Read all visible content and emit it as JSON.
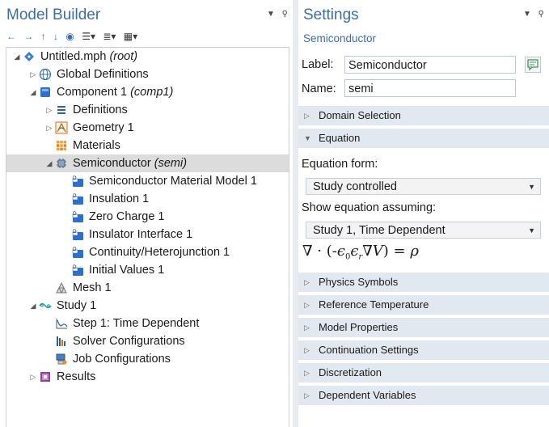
{
  "model_builder": {
    "title": "Model Builder",
    "header_icons": [
      "triangle-down-icon",
      "pin-icon"
    ],
    "toolbar": [
      "back-arrow-icon",
      "forward-arrow-icon",
      "up-arrow-icon",
      "down-arrow-icon",
      "show-icon",
      "expand-icon",
      "list-icon",
      "grid-icon"
    ],
    "tree": [
      {
        "label": "Untitled.mph",
        "suffix": "(root)",
        "level": 0,
        "toggle": "expanded",
        "icon": "root-file-icon"
      },
      {
        "label": "Global Definitions",
        "suffix": "",
        "level": 1,
        "toggle": "collapsed",
        "icon": "globe-icon"
      },
      {
        "label": "Component 1",
        "suffix": "(comp1)",
        "level": 1,
        "toggle": "expanded",
        "icon": "component-icon"
      },
      {
        "label": "Definitions",
        "suffix": "",
        "level": 2,
        "toggle": "collapsed",
        "icon": "definitions-icon"
      },
      {
        "label": "Geometry 1",
        "suffix": "",
        "level": 2,
        "toggle": "collapsed",
        "icon": "geometry-icon"
      },
      {
        "label": "Materials",
        "suffix": "",
        "level": 2,
        "toggle": "none",
        "icon": "materials-icon"
      },
      {
        "label": "Semiconductor",
        "suffix": "(semi)",
        "level": 2,
        "toggle": "expanded",
        "icon": "semiconductor-icon",
        "selected": true
      },
      {
        "label": "Semiconductor Material Model 1",
        "suffix": "",
        "level": 3,
        "toggle": "none",
        "icon": "physics-node-icon"
      },
      {
        "label": "Insulation 1",
        "suffix": "",
        "level": 3,
        "toggle": "none",
        "icon": "physics-node-icon"
      },
      {
        "label": "Zero Charge 1",
        "suffix": "",
        "level": 3,
        "toggle": "none",
        "icon": "physics-node-icon"
      },
      {
        "label": "Insulator Interface 1",
        "suffix": "",
        "level": 3,
        "toggle": "none",
        "icon": "physics-node-icon"
      },
      {
        "label": "Continuity/Heterojunction 1",
        "suffix": "",
        "level": 3,
        "toggle": "none",
        "icon": "physics-node-icon"
      },
      {
        "label": "Initial Values 1",
        "suffix": "",
        "level": 3,
        "toggle": "none",
        "icon": "physics-node-icon"
      },
      {
        "label": "Mesh 1",
        "suffix": "",
        "level": 2,
        "toggle": "none",
        "icon": "mesh-icon"
      },
      {
        "label": "Study 1",
        "suffix": "",
        "level": 1,
        "toggle": "expanded",
        "icon": "study-icon"
      },
      {
        "label": "Step 1: Time Dependent",
        "suffix": "",
        "level": 2,
        "toggle": "none",
        "icon": "time-dependent-icon"
      },
      {
        "label": "Solver Configurations",
        "suffix": "",
        "level": 2,
        "toggle": "none",
        "icon": "solver-icon"
      },
      {
        "label": "Job Configurations",
        "suffix": "",
        "level": 2,
        "toggle": "none",
        "icon": "job-icon"
      },
      {
        "label": "Results",
        "suffix": "",
        "level": 1,
        "toggle": "collapsed",
        "icon": "results-icon"
      }
    ]
  },
  "settings": {
    "title": "Settings",
    "subtitle": "Semiconductor",
    "header_icons": [
      "triangle-down-icon",
      "pin-icon"
    ],
    "label_field": {
      "label": "Label:",
      "value": "Semiconductor"
    },
    "name_field": {
      "label": "Name:",
      "value": "semi"
    },
    "sections_top": [
      {
        "label": "Domain Selection",
        "expanded": false
      },
      {
        "label": "Equation",
        "expanded": true
      }
    ],
    "equation_form_label": "Equation form:",
    "equation_form_value": "Study controlled",
    "show_equation_label": "Show equation assuming:",
    "show_equation_value": "Study 1, Time Dependent",
    "equation_text": "∇ · (-ε₀εᵣ∇V) = ρ",
    "sections_bottom": [
      {
        "label": "Physics Symbols",
        "expanded": false
      },
      {
        "label": "Reference Temperature",
        "expanded": false
      },
      {
        "label": "Model Properties",
        "expanded": false
      },
      {
        "label": "Continuation Settings",
        "expanded": false
      },
      {
        "label": "Discretization",
        "expanded": false
      },
      {
        "label": "Dependent Variables",
        "expanded": false
      }
    ]
  },
  "colors": {
    "accent": "#3c6ea4",
    "section_bg": "#e2e8f0",
    "selected_row": "#dcdcdc",
    "divider": "#e8ebef"
  }
}
